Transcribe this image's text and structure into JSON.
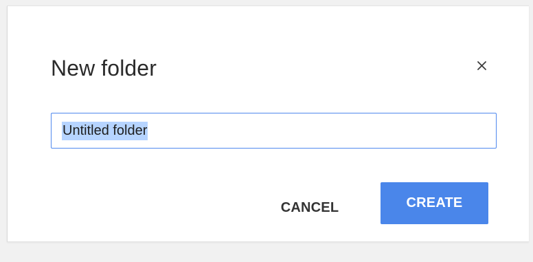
{
  "dialog": {
    "title": "New folder",
    "close_icon": "close-icon",
    "input": {
      "value": "Untitled folder",
      "selected": true
    },
    "buttons": {
      "cancel": "CANCEL",
      "create": "CREATE"
    }
  },
  "colors": {
    "primary": "#4a86ea",
    "selection": "#b6d4ff",
    "input_border": "#4f88ee"
  }
}
